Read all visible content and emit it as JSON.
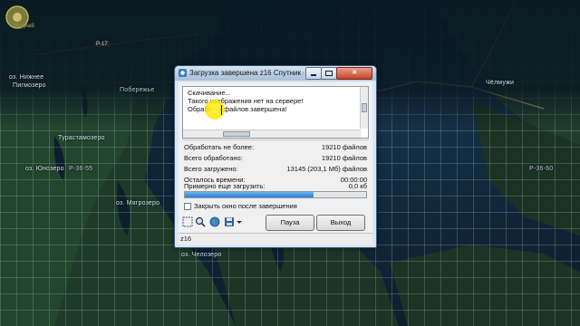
{
  "map": {
    "labels": {
      "nizhnee_1": "оз. Нижнее",
      "nizhnee_2": "Пигмозеро",
      "pobereje": "Побережье",
      "turastamozero": "Турастамозеро",
      "yunozero": "оз. Юнозеро",
      "myagrozero": "оз. Мягрозеро",
      "chelozero": "оз. Челозеро",
      "chelmuzhi": "Чёлмужи",
      "zone_left": "P-36-55",
      "zone_right": "P-36-60",
      "road": "P-17"
    },
    "watermark": "МедиаS"
  },
  "window": {
    "title": "Загрузка завершена z16 Спутник (...",
    "close_label": "✕",
    "log": [
      "Скачивание...",
      "Такого изображения нет на сервере!",
      "Обработка файлов завершена!"
    ],
    "stats": [
      {
        "label": "Обработать не более:",
        "value": "19210 файлов"
      },
      {
        "label": "Всего обработано:",
        "value": "19210 файлов"
      },
      {
        "label": "Всего загружено:",
        "value": "13145 (203,1 Мб) файлов"
      },
      {
        "label": "Осталось времени:",
        "value": "00:00:00"
      },
      {
        "label": "Примерно еще загрузить:",
        "value": "0,0 кб"
      }
    ],
    "progress": 0.71,
    "close_after_label": "Закрыть окно после завершения",
    "pause_label": "Пауза",
    "exit_label": "Выход",
    "status": "z16"
  },
  "colors": {
    "window_bg": "#f0f0f0",
    "progress": "#2a7fd4",
    "highlight": "#ffe600"
  }
}
